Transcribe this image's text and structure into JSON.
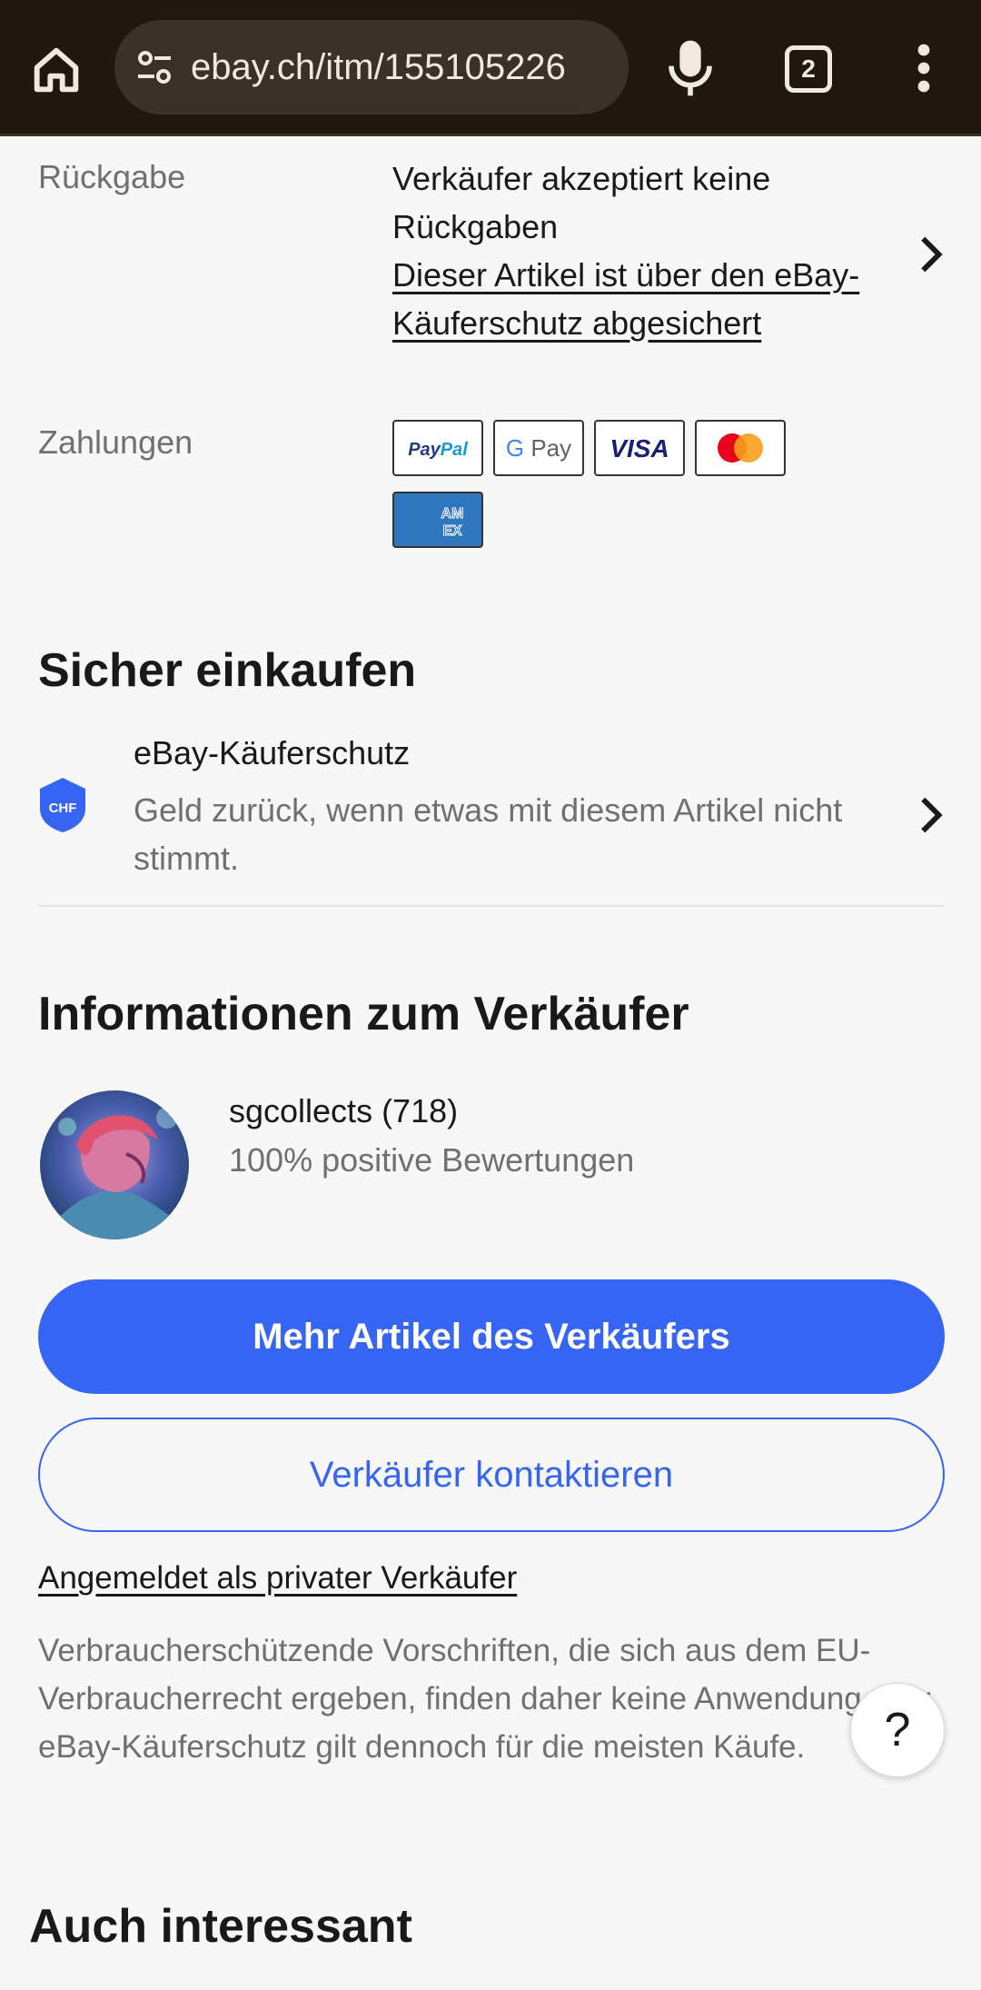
{
  "browser": {
    "url": "ebay.ch/itm/155105226",
    "tab_count": "2",
    "icons": [
      "home-icon",
      "site-settings-icon",
      "microphone-icon",
      "tabs-icon",
      "more-vert-icon"
    ]
  },
  "returns": {
    "label": "Rückgabe",
    "text": "Verkäufer akzeptiert keine Rückgaben",
    "link": "Dieser Artikel ist über den eBay-Käuferschutz abgesichert"
  },
  "payments": {
    "label": "Zahlungen",
    "methods": [
      "PayPal",
      "G Pay",
      "VISA",
      "Mastercard",
      "AMEX"
    ]
  },
  "safe_shopping": {
    "title": "Sicher einkaufen",
    "badge": "CHF",
    "item_title": "eBay-Käuferschutz",
    "item_text": "Geld zurück, wenn etwas mit diesem Artikel nicht stimmt."
  },
  "seller": {
    "title": "Informationen zum Verkäufer",
    "name": "sgcollects (718)",
    "feedback": "100% positive Bewertungen",
    "more_button": "Mehr Artikel des Verkäufers",
    "contact_button": "Verkäufer kontaktieren",
    "private_link": "Angemeldet als privater Verkäufer",
    "notice": "Verbraucherschützende Vorschriften, die sich aus dem EU-Verbraucherrecht ergeben, finden daher keine Anwendung. Der eBay-Käuferschutz gilt dennoch für die meisten Käufe."
  },
  "help_button": "?",
  "also_interesting": {
    "title": "Auch interessant"
  },
  "colors": {
    "accent": "#3665f3",
    "toolbar": "#201810"
  }
}
